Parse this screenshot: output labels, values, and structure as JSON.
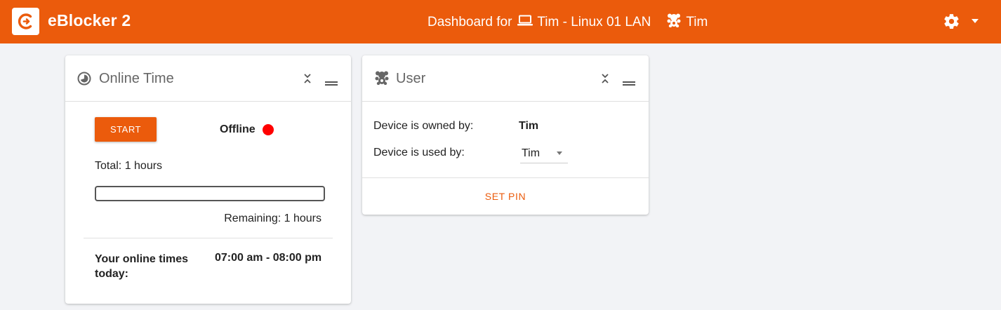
{
  "header": {
    "brand": "eBlocker 2",
    "dashboard_prefix": "Dashboard for",
    "device_name": "Tim - Linux 01 LAN",
    "user_name": "Tim",
    "accent_color": "#eb5b0c"
  },
  "icons": {
    "logo": "eblocker-logo-icon",
    "device": "laptop-icon",
    "user": "teddy-bear-icon",
    "settings": "gear-icon",
    "menu": "caret-down-icon"
  },
  "online_time_card": {
    "title": "Online Time",
    "start_label": "START",
    "status": "Offline",
    "status_color": "#ff0000",
    "total": "Total: 1 hours",
    "progress_fraction": 0,
    "remaining": "Remaining: 1 hours",
    "online_times_label": "Your online times today:",
    "online_times_value": "07:00 am - 08:00 pm"
  },
  "user_card": {
    "title": "User",
    "owned_label": "Device is owned by:",
    "owned_value": "Tim",
    "used_label": "Device is used by:",
    "used_value": "Tim",
    "set_pin_label": "SET PIN"
  }
}
